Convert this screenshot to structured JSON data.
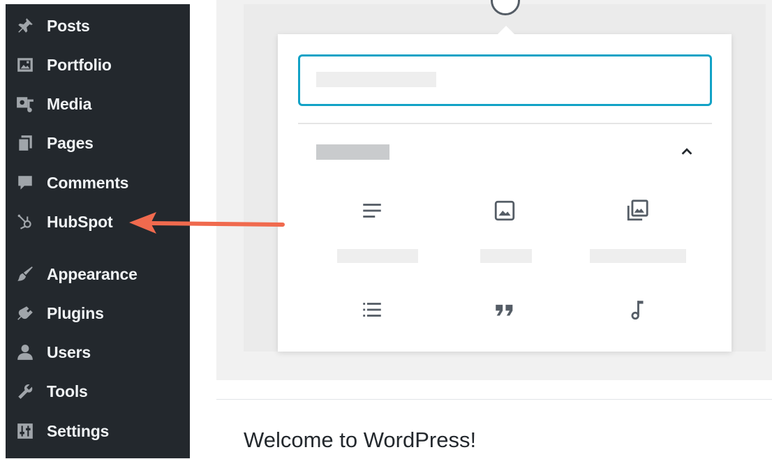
{
  "sidebar": {
    "items": [
      {
        "label": "Posts",
        "icon": "pushpin-icon"
      },
      {
        "label": "Portfolio",
        "icon": "portfolio-icon"
      },
      {
        "label": "Media",
        "icon": "media-icon"
      },
      {
        "label": "Pages",
        "icon": "pages-icon"
      },
      {
        "label": "Comments",
        "icon": "comment-icon"
      },
      {
        "label": "HubSpot",
        "icon": "hubspot-sprocket-icon"
      },
      {
        "label": "Appearance",
        "icon": "paintbrush-icon"
      },
      {
        "label": "Plugins",
        "icon": "plugin-icon"
      },
      {
        "label": "Users",
        "icon": "user-icon"
      },
      {
        "label": "Tools",
        "icon": "wrench-icon"
      },
      {
        "label": "Settings",
        "icon": "settings-sliders-icon"
      }
    ]
  },
  "inserter": {
    "search_value": "",
    "blocks": [
      {
        "icon": "paragraph-icon"
      },
      {
        "icon": "image-icon"
      },
      {
        "icon": "gallery-icon"
      },
      {
        "icon": "list-icon"
      },
      {
        "icon": "quote-icon"
      },
      {
        "icon": "audio-icon"
      }
    ]
  },
  "welcome": {
    "title": "Welcome to WordPress!"
  },
  "colors": {
    "sidebar_bg": "#23282d",
    "sidebar_text": "#f0f3f5",
    "search_border": "#12a2c6",
    "arrow": "#f06a4e"
  }
}
